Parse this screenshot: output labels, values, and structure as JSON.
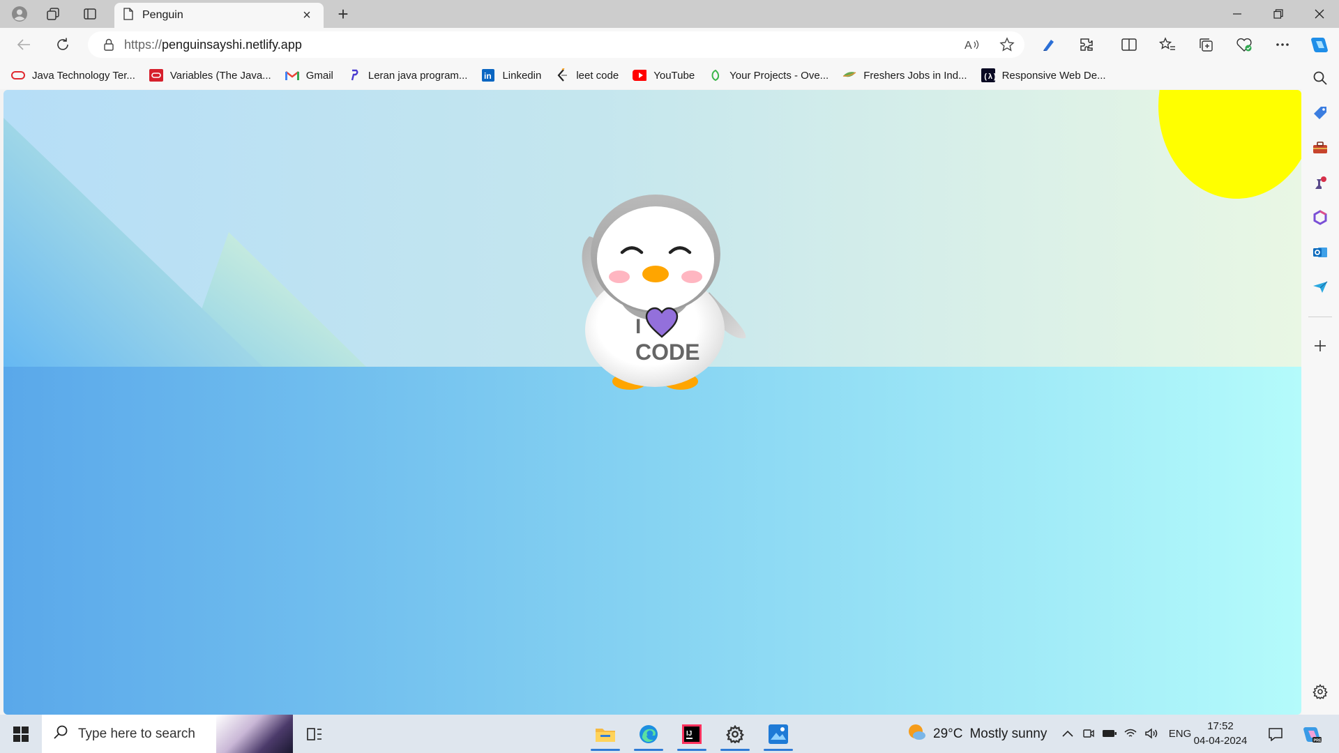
{
  "browser": {
    "tab_title": "Penguin",
    "url_scheme": "https://",
    "url_host": "penguinsayshi.netlify.app"
  },
  "bookmarks": [
    {
      "label": "Java Technology Ter...",
      "icon": "oracle-icon",
      "color": "#e0282e"
    },
    {
      "label": "Variables (The Java...",
      "icon": "oracle-box-icon",
      "color": "#d6202c"
    },
    {
      "label": "Gmail",
      "icon": "gmail-icon",
      "color": "#ea4335"
    },
    {
      "label": "Leran java program...",
      "icon": "javatpoint-icon",
      "color": "#4a3bd0"
    },
    {
      "label": "Linkedin",
      "icon": "linkedin-icon",
      "color": "#0a66c2"
    },
    {
      "label": "leet code",
      "icon": "leetcode-icon",
      "color": "#222222"
    },
    {
      "label": "YouTube",
      "icon": "youtube-icon",
      "color": "#ff0000"
    },
    {
      "label": "Your Projects - Ove...",
      "icon": "projects-icon",
      "color": "#3bb54a"
    },
    {
      "label": "Freshers Jobs in Ind...",
      "icon": "jobs-icon",
      "color": "#6aa84f"
    },
    {
      "label": "Responsive Web De...",
      "icon": "freecodecamp-icon",
      "color": "#0a0a23"
    }
  ],
  "page": {
    "shirt_line1": "I",
    "shirt_line2": "CODE",
    "colors": {
      "sun": "#ffff00",
      "heart": "#9370db",
      "beak": "#ffa500",
      "cheeks": "#ffb6c1"
    }
  },
  "taskbar": {
    "search_placeholder": "Type here to search",
    "weather_temp": "29°C",
    "weather_desc": "Mostly sunny",
    "language": "ENG",
    "time": "17:52",
    "date": "04-04-2024"
  }
}
